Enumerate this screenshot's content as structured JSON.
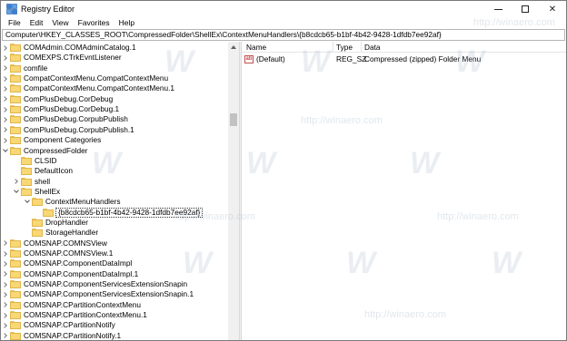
{
  "window": {
    "title": "Registry Editor",
    "controls": {
      "minimize": "",
      "maximize": "",
      "close": "✕"
    }
  },
  "menu": [
    "File",
    "Edit",
    "View",
    "Favorites",
    "Help"
  ],
  "address": "Computer\\HKEY_CLASSES_ROOT\\CompressedFolder\\ShellEx\\ContextMenuHandlers\\{b8cdcb65-b1bf-4b42-9428-1dfdb7ee92af}",
  "tree": [
    {
      "label": "COMAdmin.COMAdminCatalog.1",
      "level": 0,
      "expander": "collapsed"
    },
    {
      "label": "COMEXPS.CTrkEvntListener",
      "level": 0,
      "expander": "collapsed"
    },
    {
      "label": "comfile",
      "level": 0,
      "expander": "collapsed"
    },
    {
      "label": "CompatContextMenu.CompatContextMenu",
      "level": 0,
      "expander": "collapsed"
    },
    {
      "label": "CompatContextMenu.CompatContextMenu.1",
      "level": 0,
      "expander": "collapsed"
    },
    {
      "label": "ComPlusDebug.CorDebug",
      "level": 0,
      "expander": "collapsed"
    },
    {
      "label": "ComPlusDebug.CorDebug.1",
      "level": 0,
      "expander": "collapsed"
    },
    {
      "label": "ComPlusDebug.CorpubPublish",
      "level": 0,
      "expander": "collapsed"
    },
    {
      "label": "ComPlusDebug.CorpubPublish.1",
      "level": 0,
      "expander": "collapsed"
    },
    {
      "label": "Component Categories",
      "level": 0,
      "expander": "collapsed"
    },
    {
      "label": "CompressedFolder",
      "level": 0,
      "expander": "expanded"
    },
    {
      "label": "CLSID",
      "level": 1,
      "expander": "none"
    },
    {
      "label": "DefaultIcon",
      "level": 1,
      "expander": "none"
    },
    {
      "label": "shell",
      "level": 1,
      "expander": "collapsed"
    },
    {
      "label": "ShellEx",
      "level": 1,
      "expander": "expanded"
    },
    {
      "label": "ContextMenuHandlers",
      "level": 2,
      "expander": "expanded"
    },
    {
      "label": "{b8cdcb65-b1bf-4b42-9428-1dfdb7ee92af}",
      "level": 3,
      "expander": "none",
      "selected": true
    },
    {
      "label": "DropHandler",
      "level": 2,
      "expander": "none"
    },
    {
      "label": "StorageHandler",
      "level": 2,
      "expander": "none"
    },
    {
      "label": "COMSNAP.COMNSView",
      "level": 0,
      "expander": "collapsed"
    },
    {
      "label": "COMSNAP.COMNSView.1",
      "level": 0,
      "expander": "collapsed"
    },
    {
      "label": "COMSNAP.ComponentDataImpl",
      "level": 0,
      "expander": "collapsed"
    },
    {
      "label": "COMSNAP.ComponentDataImpl.1",
      "level": 0,
      "expander": "collapsed"
    },
    {
      "label": "COMSNAP.ComponentServicesExtensionSnapin",
      "level": 0,
      "expander": "collapsed"
    },
    {
      "label": "COMSNAP.ComponentServicesExtensionSnapin.1",
      "level": 0,
      "expander": "collapsed"
    },
    {
      "label": "COMSNAP.CPartitionContextMenu",
      "level": 0,
      "expander": "collapsed"
    },
    {
      "label": "COMSNAP.CPartitionContextMenu.1",
      "level": 0,
      "expander": "collapsed"
    },
    {
      "label": "COMSNAP.CPartitionNotify",
      "level": 0,
      "expander": "collapsed"
    },
    {
      "label": "COMSNAP.CPartitionNotify.1",
      "level": 0,
      "expander": "collapsed"
    }
  ],
  "list": {
    "headers": {
      "name": "Name",
      "type": "Type",
      "data": "Data"
    },
    "rows": [
      {
        "icon": "ab",
        "name": "(Default)",
        "type": "REG_SZ",
        "data": "Compressed (zipped) Folder Menu"
      }
    ]
  },
  "watermark": {
    "glyph": "W",
    "text": "http://winaero.com"
  },
  "colors": {
    "folder": "#f8d775",
    "folder_border": "#e0b64a",
    "string_icon": "#c0504d"
  }
}
